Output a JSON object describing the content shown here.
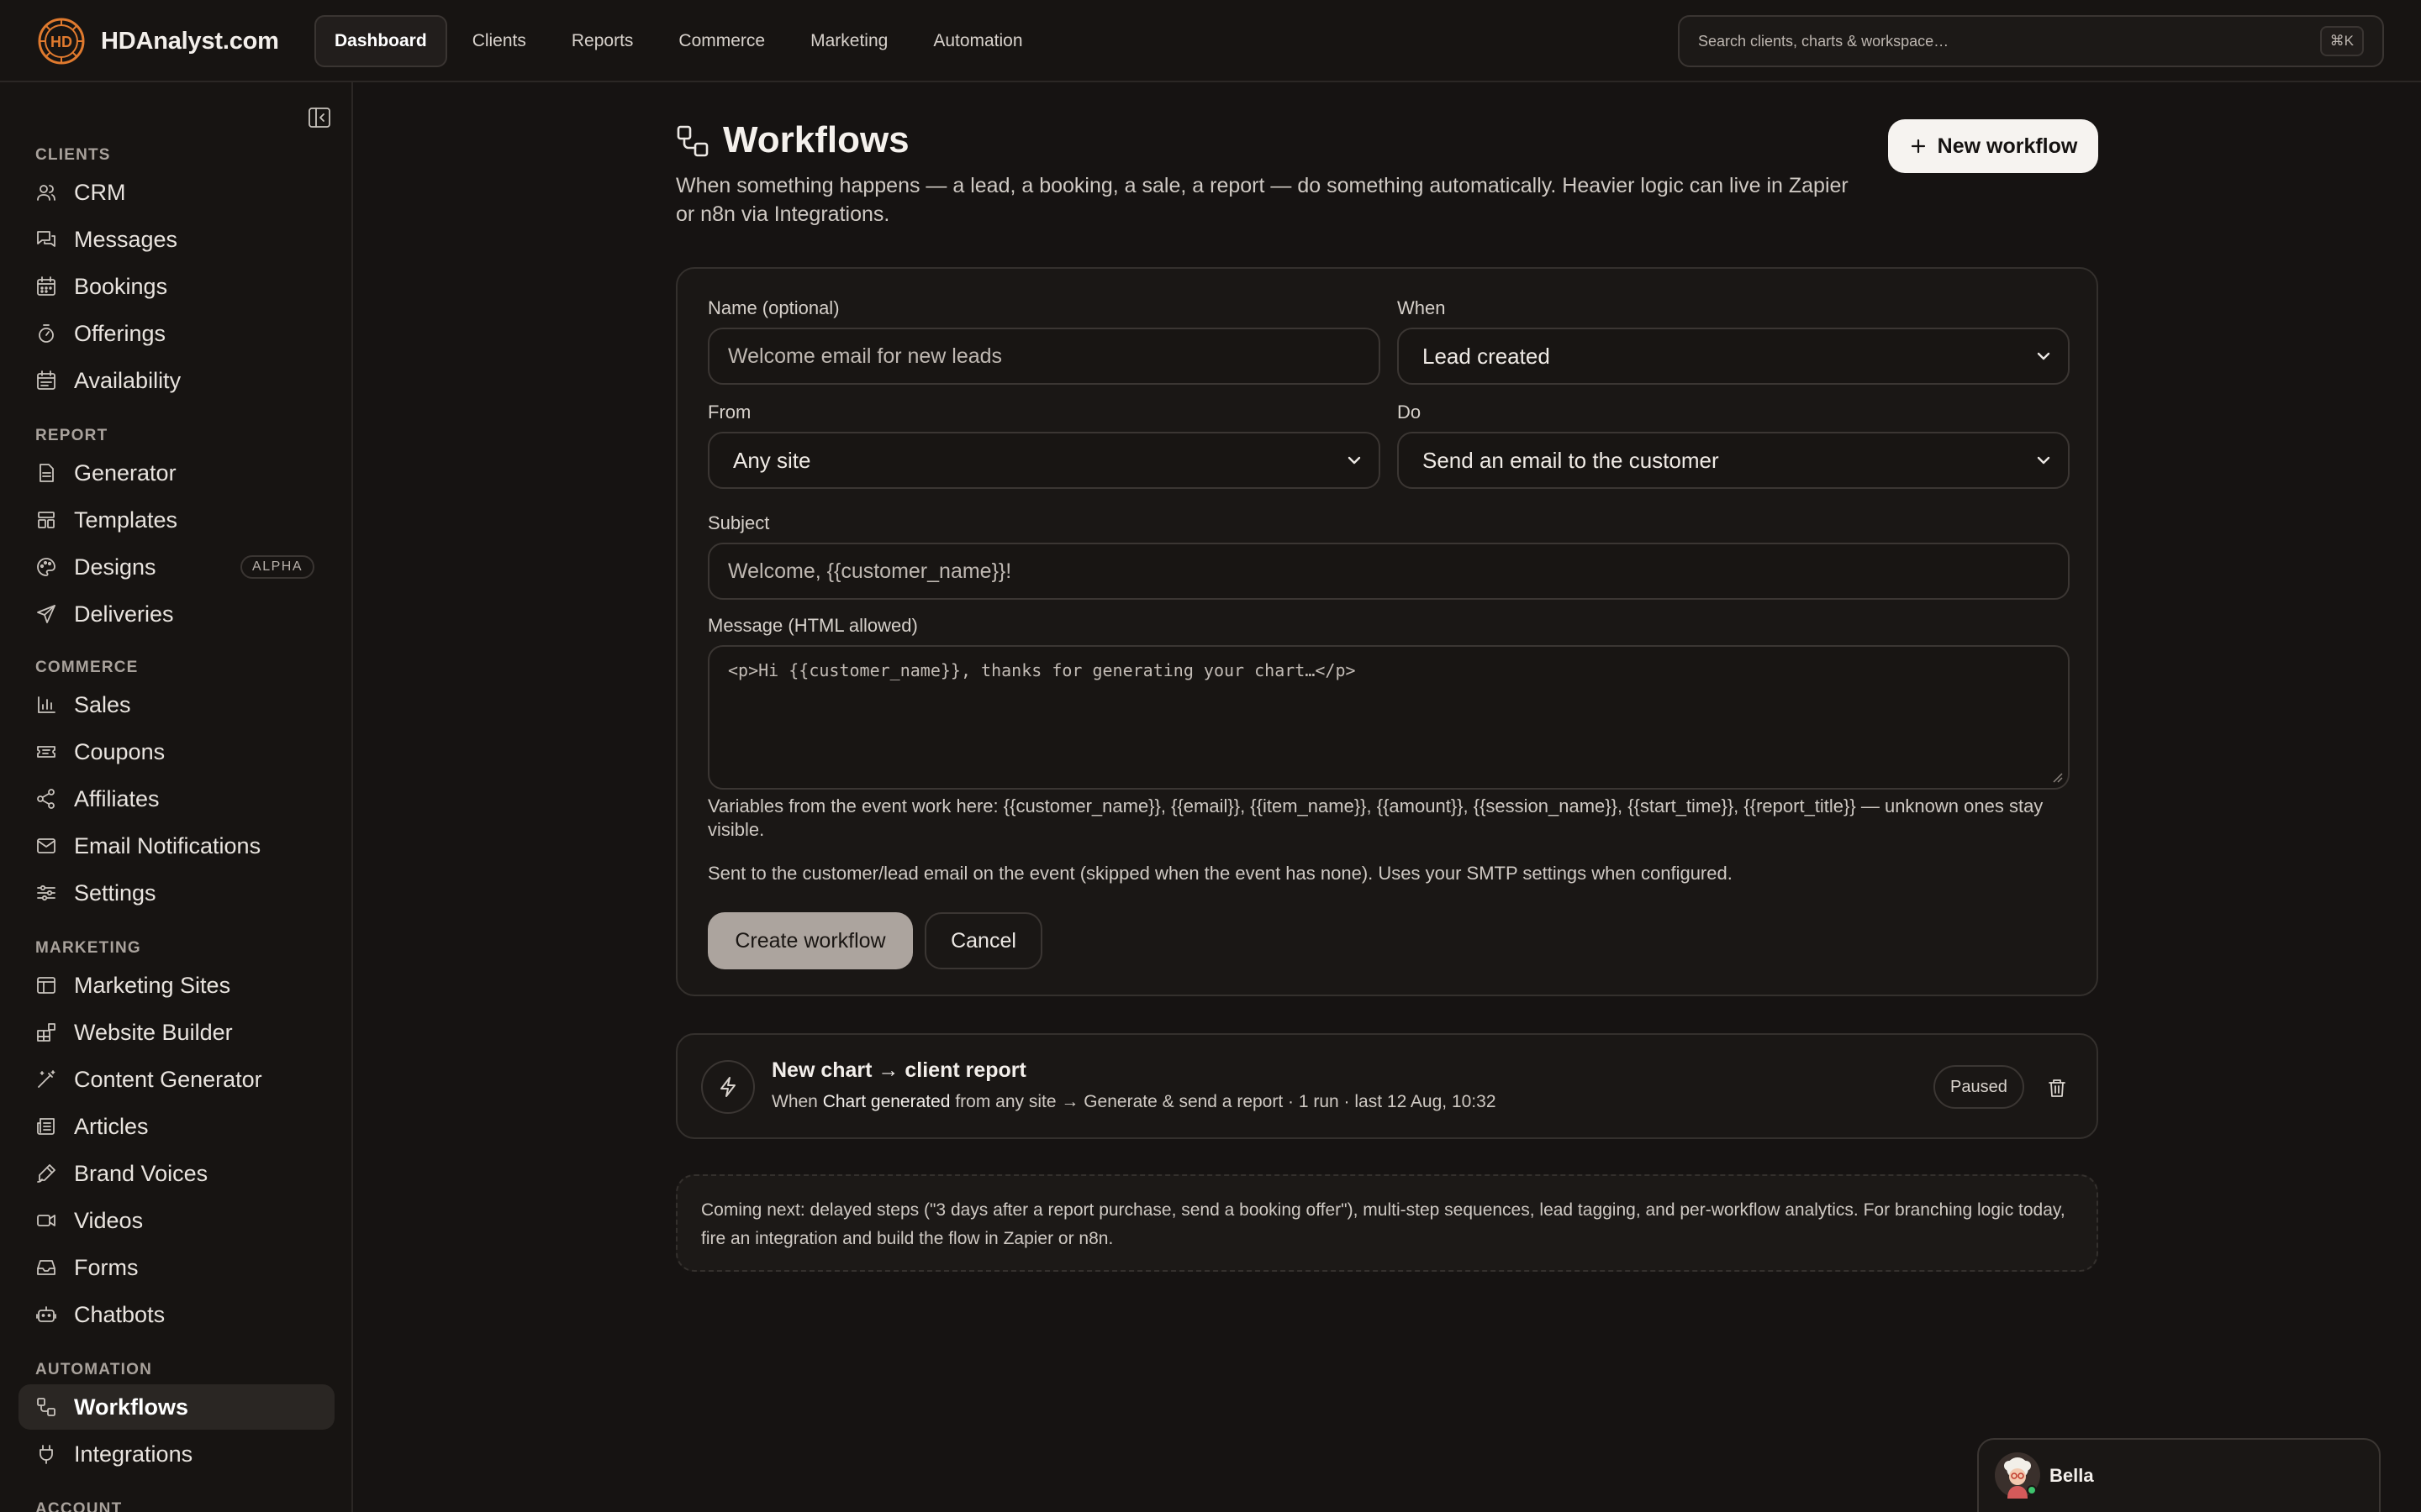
{
  "brand": {
    "name": "HDAnalyst.com"
  },
  "topnav": {
    "items": [
      {
        "label": "Dashboard",
        "active": true
      },
      {
        "label": "Clients"
      },
      {
        "label": "Reports"
      },
      {
        "label": "Commerce"
      },
      {
        "label": "Marketing"
      },
      {
        "label": "Automation"
      }
    ]
  },
  "search": {
    "placeholder": "Search clients, charts & workspace…",
    "shortcut": "⌘K"
  },
  "sidebar": {
    "sections": [
      {
        "title": "CLIENTS",
        "items": [
          {
            "label": "CRM",
            "icon": "users-icon"
          },
          {
            "label": "Messages",
            "icon": "messages-icon"
          },
          {
            "label": "Bookings",
            "icon": "calendar-icon"
          },
          {
            "label": "Offerings",
            "icon": "timer-icon"
          },
          {
            "label": "Availability",
            "icon": "calendar-check-icon"
          }
        ]
      },
      {
        "title": "REPORT",
        "items": [
          {
            "label": "Generator",
            "icon": "file-icon"
          },
          {
            "label": "Templates",
            "icon": "layout-icon"
          },
          {
            "label": "Designs",
            "icon": "palette-icon",
            "badge": "ALPHA"
          },
          {
            "label": "Deliveries",
            "icon": "send-icon"
          }
        ]
      },
      {
        "title": "COMMERCE",
        "items": [
          {
            "label": "Sales",
            "icon": "bar-chart-icon"
          },
          {
            "label": "Coupons",
            "icon": "ticket-icon"
          },
          {
            "label": "Affiliates",
            "icon": "share-icon"
          },
          {
            "label": "Email Notifications",
            "icon": "mail-icon"
          },
          {
            "label": "Settings",
            "icon": "sliders-icon"
          }
        ]
      },
      {
        "title": "MARKETING",
        "items": [
          {
            "label": "Marketing Sites",
            "icon": "browser-icon"
          },
          {
            "label": "Website Builder",
            "icon": "blocks-icon"
          },
          {
            "label": "Content Generator",
            "icon": "wand-icon"
          },
          {
            "label": "Articles",
            "icon": "newspaper-icon"
          },
          {
            "label": "Brand Voices",
            "icon": "pen-icon"
          },
          {
            "label": "Videos",
            "icon": "video-icon"
          },
          {
            "label": "Forms",
            "icon": "inbox-icon"
          },
          {
            "label": "Chatbots",
            "icon": "bot-icon"
          }
        ]
      },
      {
        "title": "AUTOMATION",
        "items": [
          {
            "label": "Workflows",
            "icon": "workflow-icon",
            "active": true
          },
          {
            "label": "Integrations",
            "icon": "plug-icon"
          }
        ]
      },
      {
        "title": "ACCOUNT",
        "items": []
      }
    ]
  },
  "page": {
    "title": "Workflows",
    "description": "When something happens — a lead, a booking, a sale, a report — do something automatically. Heavier logic can live in Zapier or n8n via Integrations.",
    "new_button": "New workflow"
  },
  "form": {
    "name_label": "Name (optional)",
    "name_placeholder": "Welcome email for new leads",
    "when_label": "When",
    "when_value": "Lead created",
    "from_label": "From",
    "from_value": "Any site",
    "do_label": "Do",
    "do_value": "Send an email to the customer",
    "subject_label": "Subject",
    "subject_placeholder": "Welcome, {{customer_name}}!",
    "message_label": "Message (HTML allowed)",
    "message_placeholder": "<p>Hi {{customer_name}}, thanks for generating your chart…</p>",
    "variables_help": "Variables from the event work here: {{customer_name}}, {{email}}, {{item_name}}, {{amount}}, {{session_name}}, {{start_time}}, {{report_title}} — unknown ones stay visible.",
    "sent_help": "Sent to the customer/lead email on the event (skipped when the event has none). Uses your SMTP settings when configured.",
    "create_button": "Create workflow",
    "cancel_button": "Cancel"
  },
  "workflows": [
    {
      "title": "New chart → client report",
      "meta_prefix": "When",
      "meta_trigger": "Chart generated",
      "meta_rest": "from any site → Generate & send a report · 1 run · last 12 Aug, 10:32",
      "status": "Paused"
    }
  ],
  "note": "Coming next: delayed steps (\"3 days after a report purchase, send a booking offer\"), multi-step sequences, lead tagging, and per-workflow analytics. For branching logic today, fire an integration and build the flow in Zapier or n8n.",
  "chat": {
    "name": "Bella"
  },
  "colors": {
    "background": "#161312",
    "accent": "#f6f3f0",
    "brand_orange": "#e07a2e"
  }
}
